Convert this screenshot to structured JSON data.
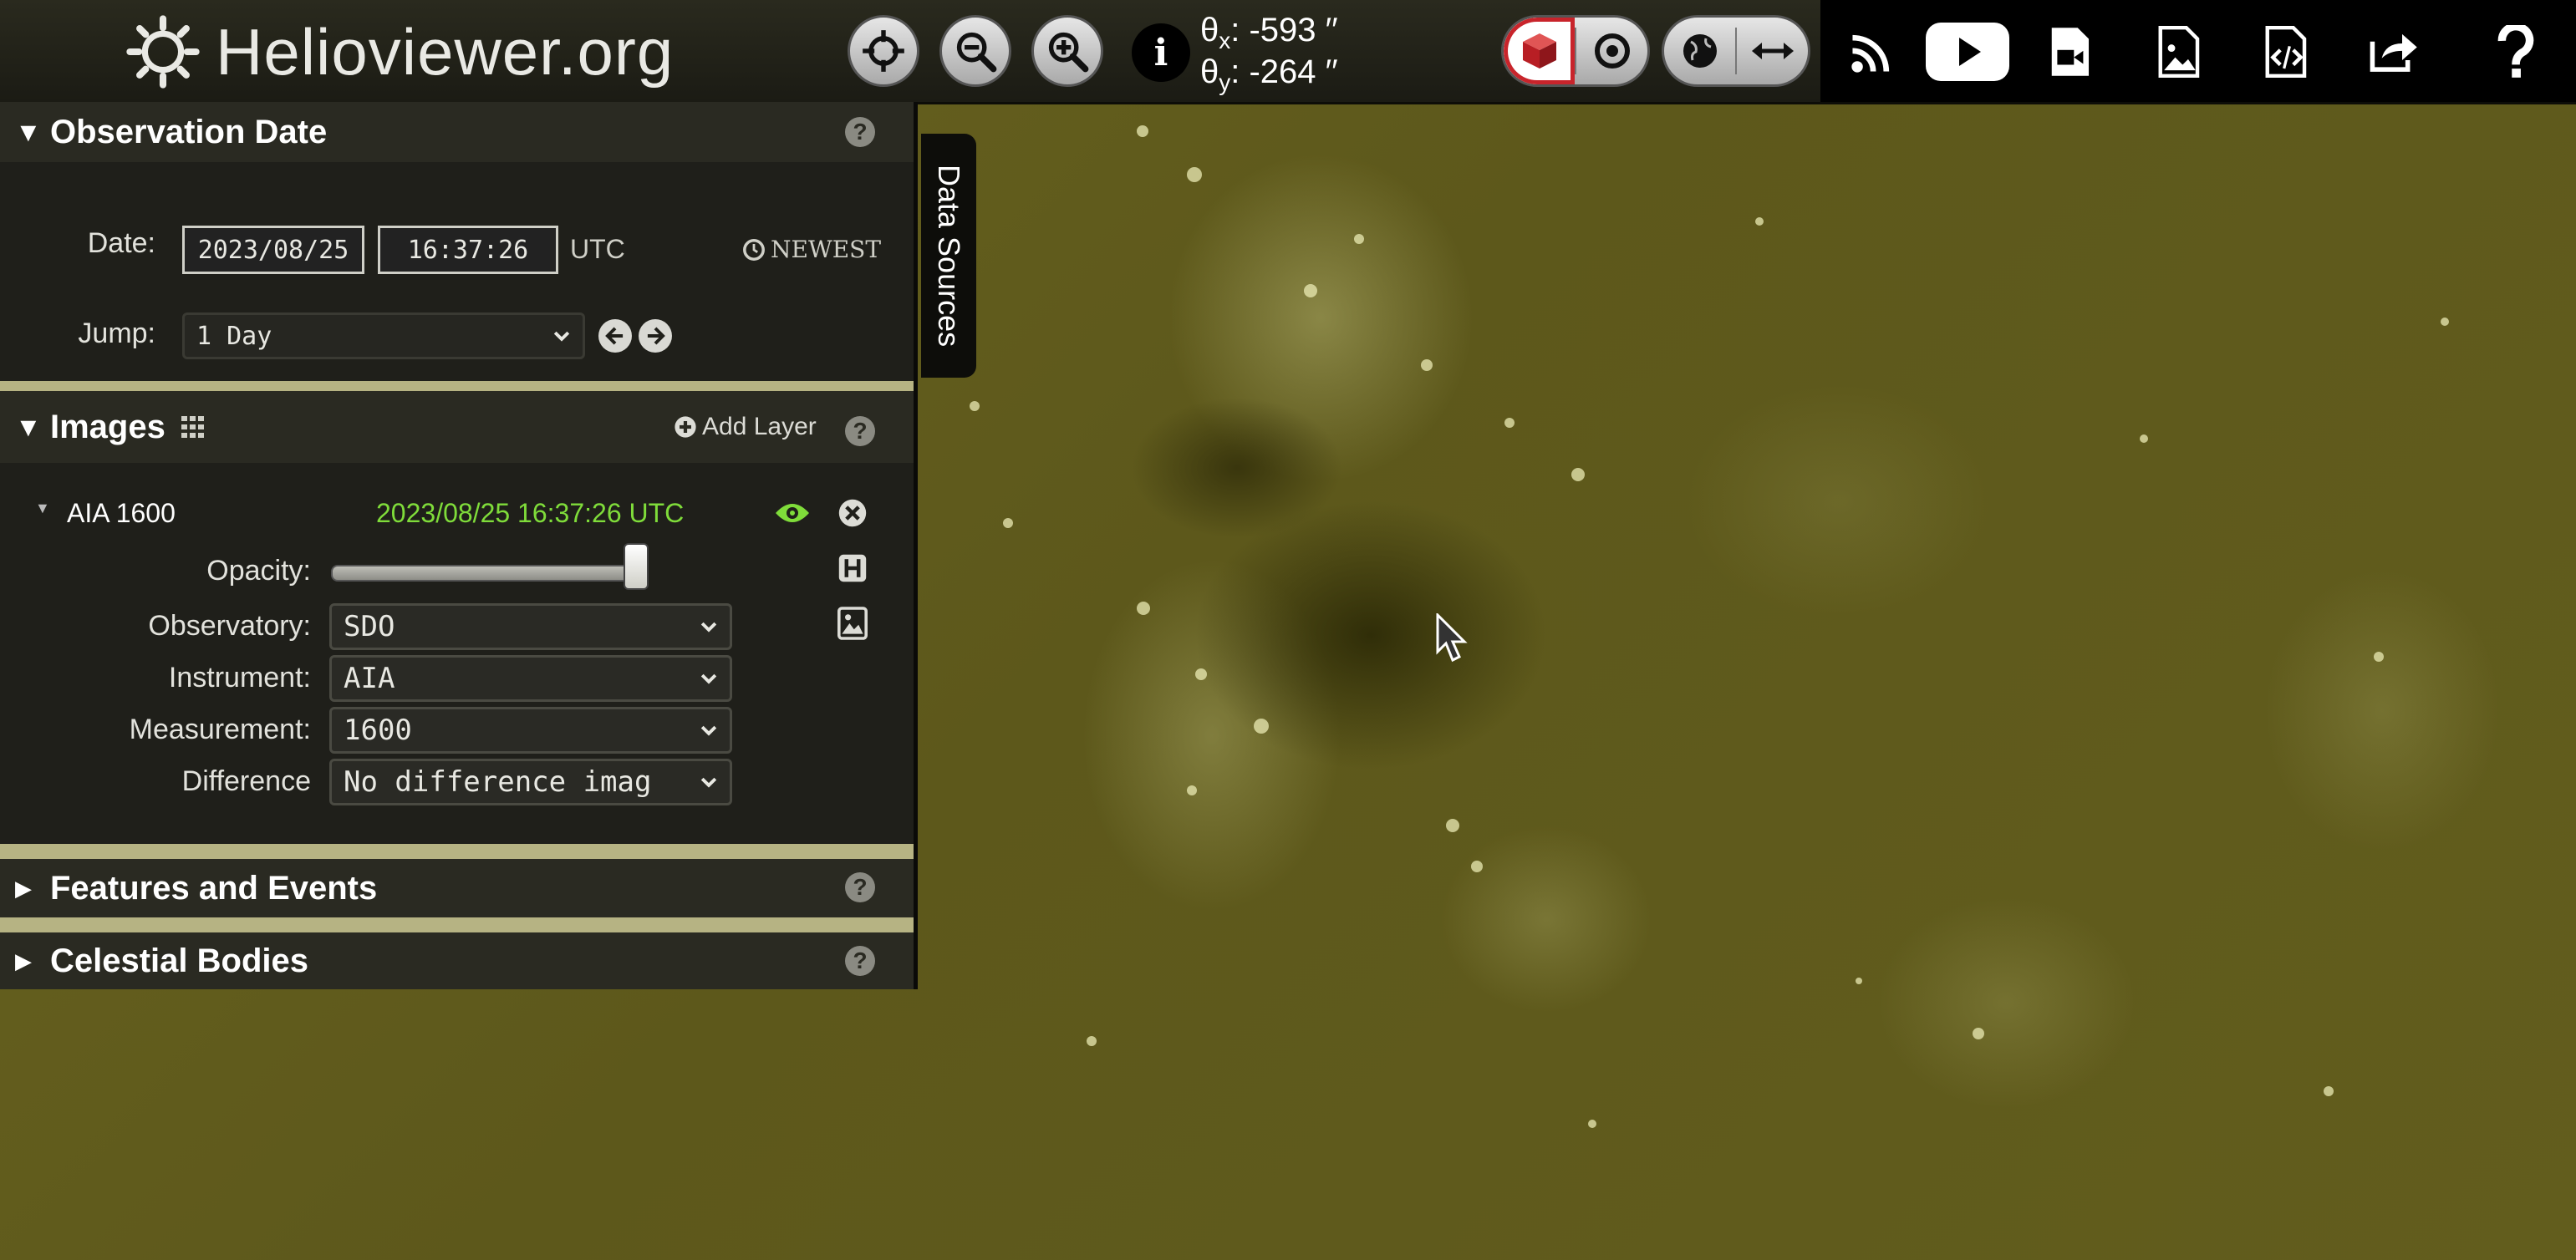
{
  "header": {
    "logo_text": "Helioviewer.org",
    "coords": {
      "theta_x_label": "θ",
      "theta_x_sub": "x",
      "theta_x_value": ": -593 ′′",
      "theta_y_label": "θ",
      "theta_y_sub": "y",
      "theta_y_value": ": -264 ′′"
    }
  },
  "observation_date": {
    "title": "Observation Date",
    "date_label": "Date:",
    "date_value": "2023/08/25",
    "time_value": "16:37:26",
    "utc": "UTC",
    "newest": "NEWEST",
    "jump_label": "Jump:",
    "jump_value": "1 Day"
  },
  "images": {
    "title": "Images",
    "add_layer": "Add Layer",
    "layer": {
      "name": "AIA 1600",
      "timestamp": "2023/08/25 16:37:26 UTC",
      "opacity_label": "Opacity:",
      "opacity": 1.0,
      "observatory_label": "Observatory:",
      "observatory": "SDO",
      "instrument_label": "Instrument:",
      "instrument": "AIA",
      "measurement_label": "Measurement:",
      "measurement": "1600",
      "difference_label": "Difference",
      "difference": "No difference imag"
    }
  },
  "features": {
    "title": "Features and Events"
  },
  "celestial": {
    "title": "Celestial Bodies"
  },
  "data_sources_tab": "Data Sources",
  "colors": {
    "accent_green": "#7fdc3a",
    "active_red": "#c8242b",
    "sun_tint": "#5e591b"
  }
}
